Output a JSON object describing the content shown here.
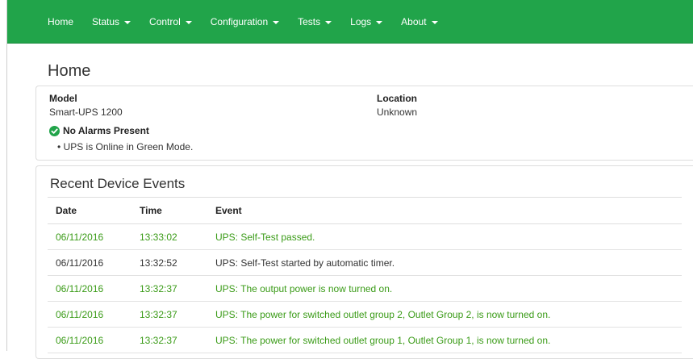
{
  "nav": {
    "items": [
      {
        "label": "Home",
        "dropdown": false
      },
      {
        "label": "Status",
        "dropdown": true
      },
      {
        "label": "Control",
        "dropdown": true
      },
      {
        "label": "Configuration",
        "dropdown": true
      },
      {
        "label": "Tests",
        "dropdown": true
      },
      {
        "label": "Logs",
        "dropdown": true
      },
      {
        "label": "About",
        "dropdown": true
      }
    ]
  },
  "page": {
    "title": "Home"
  },
  "device": {
    "model_label": "Model",
    "model_value": "Smart-UPS 1200",
    "location_label": "Location",
    "location_value": "Unknown",
    "alarm_icon": "check-circle-icon",
    "alarm_title": "No Alarms Present",
    "alarm_detail": "•  UPS is Online in Green Mode."
  },
  "events": {
    "title": "Recent Device Events",
    "columns": [
      "Date",
      "Time",
      "Event"
    ],
    "rows": [
      {
        "date": "06/11/2016",
        "time": "13:33:02",
        "event": "UPS: Self-Test passed.",
        "highlight": true
      },
      {
        "date": "06/11/2016",
        "time": "13:32:52",
        "event": "UPS: Self-Test started by automatic timer.",
        "highlight": false
      },
      {
        "date": "06/11/2016",
        "time": "13:32:37",
        "event": "UPS: The output power is now turned on.",
        "highlight": true
      },
      {
        "date": "06/11/2016",
        "time": "13:32:37",
        "event": "UPS: The power for switched outlet group 2, Outlet Group 2, is now turned on.",
        "highlight": true
      },
      {
        "date": "06/11/2016",
        "time": "13:32:37",
        "event": "UPS: The power for switched outlet group 1, Outlet Group 1, is now turned on.",
        "highlight": true
      }
    ]
  },
  "colors": {
    "navbar": "#21a44a",
    "highlight_text": "#3a9b17",
    "check_icon": "#21a44a"
  }
}
